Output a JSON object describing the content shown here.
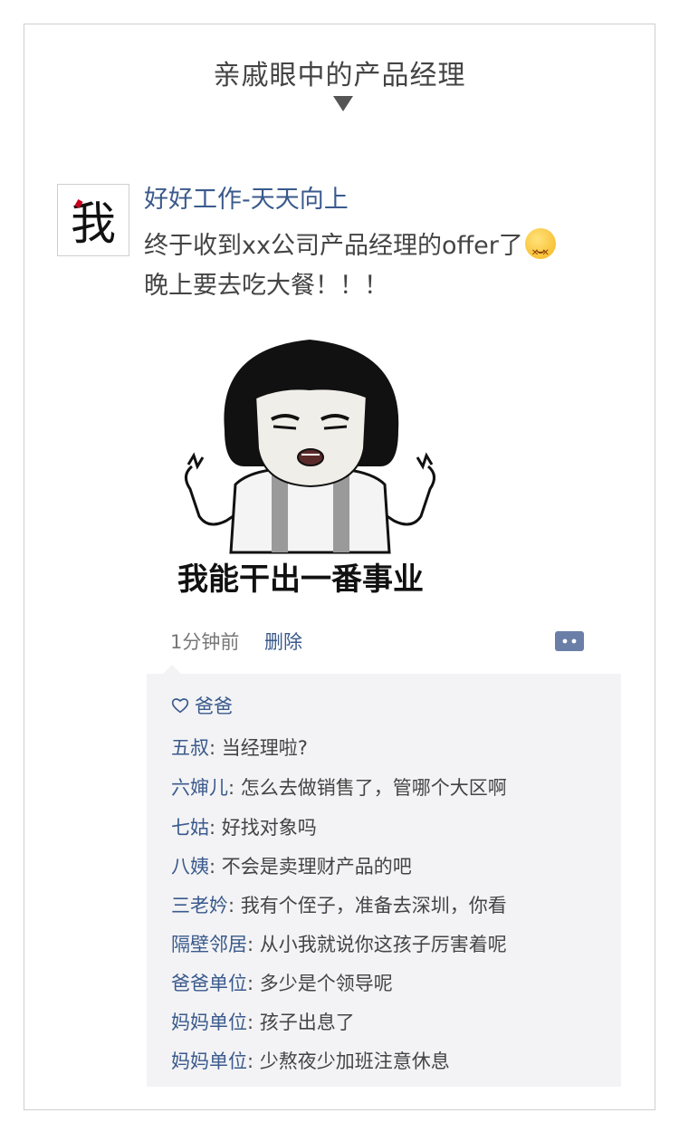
{
  "heading": "亲戚眼中的产品经理",
  "post": {
    "avatar_char": "我",
    "username": "好好工作-天天向上",
    "text_line1": "终于收到xx公司产品经理的offer了",
    "text_line2": "晚上要去吃大餐！！！",
    "emoji_icon": "dizzy-face-emoji",
    "image_caption": "我能干出一番事业",
    "time": "1分钟前",
    "delete_label": "删除"
  },
  "likes": {
    "icon": "heart-icon",
    "names": "爸爸"
  },
  "comments": [
    {
      "name": "五叔",
      "text": "当经理啦?"
    },
    {
      "name": "六婶儿",
      "text": "怎么去做销售了，管哪个大区啊"
    },
    {
      "name": "七姑",
      "text": "好找对象吗"
    },
    {
      "name": "八姨",
      "text": "不会是卖理财产品的吧"
    },
    {
      "name": "三老妗",
      "text": "我有个侄子，准备去深圳，你看"
    },
    {
      "name": "隔壁邻居",
      "text": "从小我就说你这孩子厉害着呢"
    },
    {
      "name": "爸爸单位",
      "text": "多少是个领导呢"
    },
    {
      "name": "妈妈单位",
      "text": "孩子出息了"
    },
    {
      "name": "妈妈单位",
      "text": "少熬夜少加班注意休息"
    }
  ],
  "colors": {
    "link": "#3a5a8c",
    "comment_bg": "#f3f3f5"
  }
}
